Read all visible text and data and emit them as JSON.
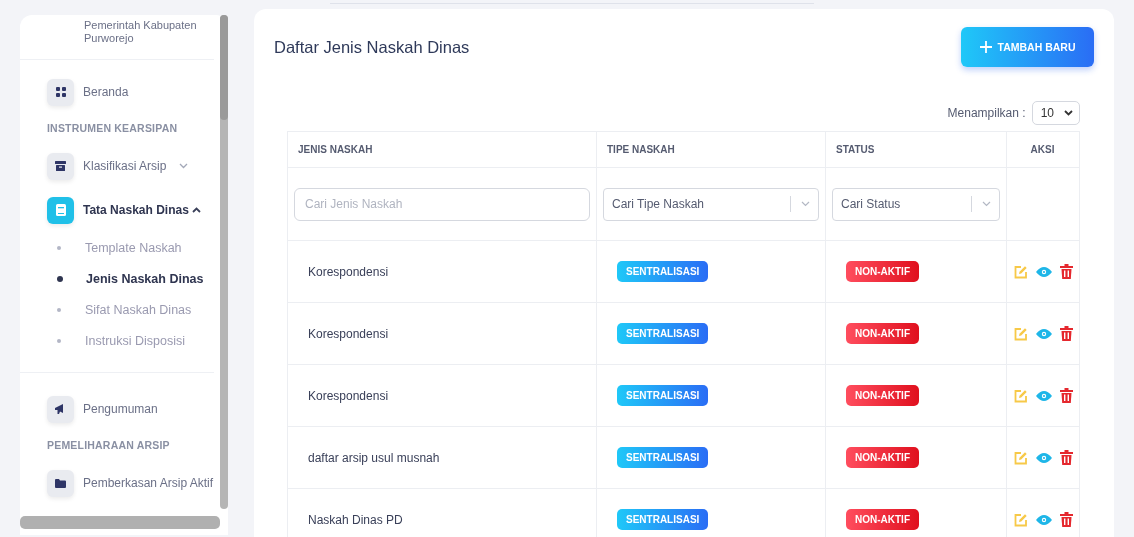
{
  "sidebar": {
    "header": "Pemerintah Kabupaten Purworejo",
    "items": [
      {
        "kind": "link",
        "label": "Beranda",
        "selected": false
      },
      {
        "kind": "section",
        "label": "INSTRUMEN KEARSIPAN"
      },
      {
        "kind": "link",
        "label": "Klasifikasi Arsip",
        "selected": false,
        "expanded": false
      },
      {
        "kind": "link",
        "label": "Tata Naskah Dinas",
        "selected": true,
        "expanded": true,
        "children": [
          {
            "label": "Template Naskah",
            "selected": false
          },
          {
            "label": "Jenis Naskah Dinas",
            "selected": true
          },
          {
            "label": "Sifat Naskah Dinas",
            "selected": false
          },
          {
            "label": "Instruksi Disposisi",
            "selected": false
          }
        ]
      },
      {
        "kind": "divider"
      },
      {
        "kind": "link",
        "label": "Pengumuman",
        "selected": false
      },
      {
        "kind": "section",
        "label": "PEMELIHARAAN ARSIP"
      },
      {
        "kind": "link",
        "label": "Pemberkasan Arsip Aktif",
        "selected": false
      }
    ]
  },
  "page": {
    "title": "Daftar Jenis Naskah Dinas",
    "add_button": "TAMBAH BARU",
    "page_size_label": "Menampilkan :",
    "page_size": "10"
  },
  "table": {
    "columns": [
      "JENIS NASKAH",
      "TIPE NASKAH",
      "STATUS",
      "AKSI"
    ],
    "filters": {
      "jenis_placeholder": "Cari Jenis Naskah",
      "tipe_placeholder": "Cari Tipe Naskah",
      "status_placeholder": "Cari Status"
    },
    "rows": [
      {
        "jenis": "Korespondensi",
        "tipe": "SENTRALISASI",
        "status": "NON-AKTIF",
        "active": false
      },
      {
        "jenis": "Korespondensi",
        "tipe": "SENTRALISASI",
        "status": "NON-AKTIF",
        "active": false
      },
      {
        "jenis": "Korespondensi",
        "tipe": "SENTRALISASI",
        "status": "NON-AKTIF",
        "active": false
      },
      {
        "jenis": "daftar arsip usul musnah",
        "tipe": "SENTRALISASI",
        "status": "NON-AKTIF",
        "active": false
      },
      {
        "jenis": "Naskah Dinas PD",
        "tipe": "SENTRALISASI",
        "status": "NON-AKTIF",
        "active": false
      }
    ]
  }
}
